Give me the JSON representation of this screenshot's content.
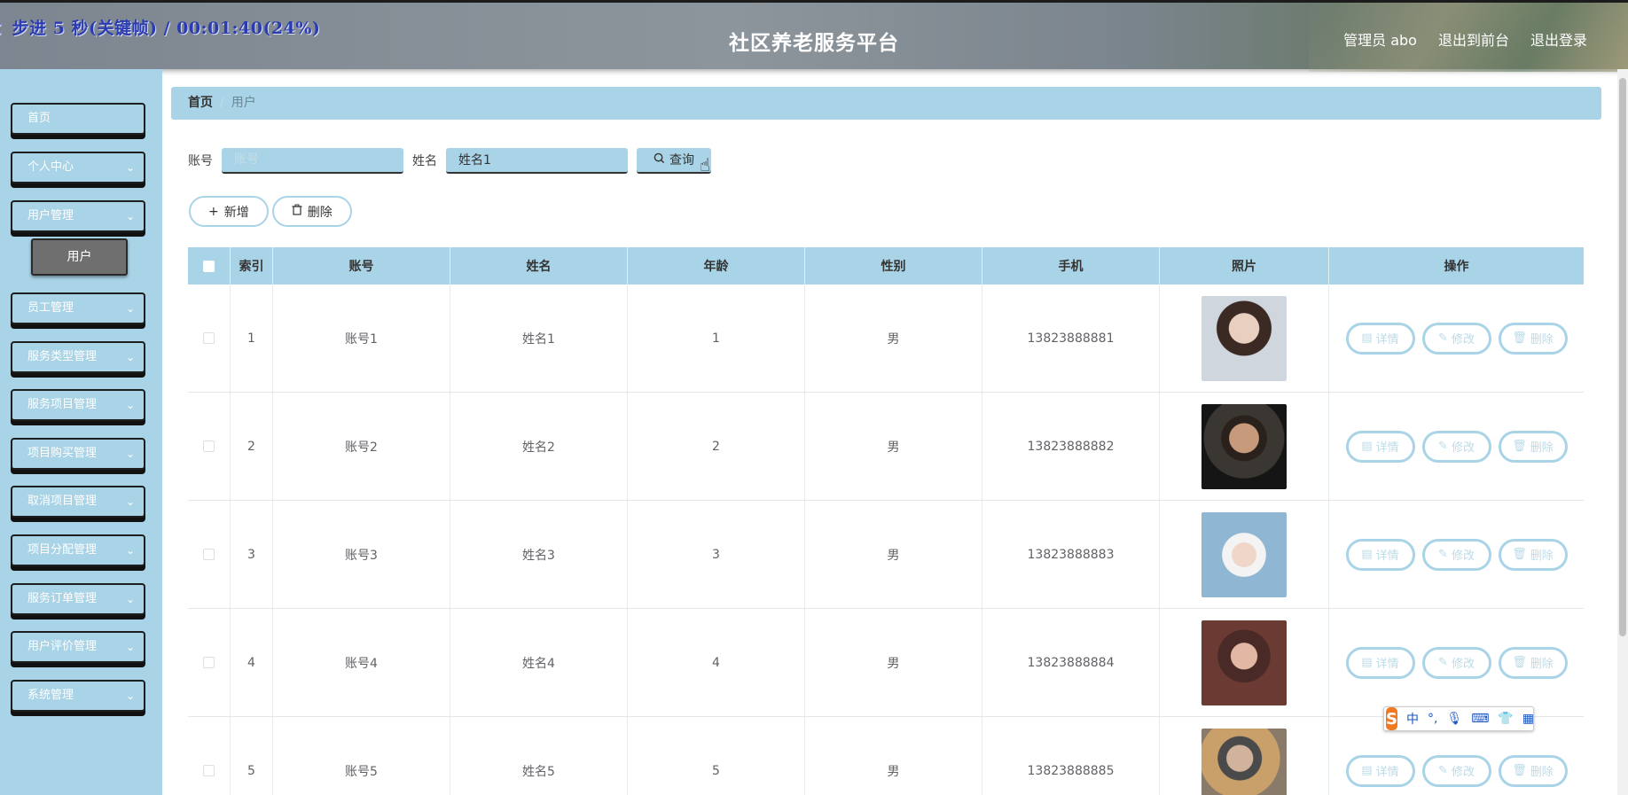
{
  "overlay": {
    "text": "：步进 5 秒(关键帧) / 00:01:40(24%)"
  },
  "header": {
    "title": "社区养老服务平台",
    "user": "管理员 abo",
    "front_link": "退出到前台",
    "logout_link": "退出登录"
  },
  "sidebar": {
    "items": [
      {
        "label": "首页",
        "has_arrow": false
      },
      {
        "label": "个人中心",
        "has_arrow": true
      },
      {
        "label": "用户管理",
        "has_arrow": true
      },
      {
        "label": "员工管理",
        "has_arrow": true
      },
      {
        "label": "服务类型管理",
        "has_arrow": true
      },
      {
        "label": "服务项目管理",
        "has_arrow": true
      },
      {
        "label": "项目购买管理",
        "has_arrow": true
      },
      {
        "label": "取消项目管理",
        "has_arrow": true
      },
      {
        "label": "项目分配管理",
        "has_arrow": true
      },
      {
        "label": "服务订单管理",
        "has_arrow": true
      },
      {
        "label": "用户评价管理",
        "has_arrow": true
      },
      {
        "label": "系统管理",
        "has_arrow": true
      }
    ],
    "submenu": {
      "label": "用户"
    }
  },
  "breadcrumb": {
    "home": "首页",
    "current": "用户"
  },
  "search": {
    "account_label": "账号",
    "account_placeholder": "账号",
    "account_value": "",
    "name_label": "姓名",
    "name_value": "姓名1",
    "query_label": "查询"
  },
  "actions": {
    "add_label": "新增",
    "delete_label": "删除"
  },
  "table": {
    "headers": {
      "index": "索引",
      "account": "账号",
      "name": "姓名",
      "age": "年龄",
      "gender": "性别",
      "phone": "手机",
      "photo": "照片",
      "ops": "操作"
    },
    "rows": [
      {
        "index": "1",
        "account": "账号1",
        "name": "姓名1",
        "age": "1",
        "gender": "男",
        "phone": "13823888881"
      },
      {
        "index": "2",
        "account": "账号2",
        "name": "姓名2",
        "age": "2",
        "gender": "男",
        "phone": "13823888882"
      },
      {
        "index": "3",
        "account": "账号3",
        "name": "姓名3",
        "age": "3",
        "gender": "男",
        "phone": "13823888883"
      },
      {
        "index": "4",
        "account": "账号4",
        "name": "姓名4",
        "age": "4",
        "gender": "男",
        "phone": "13823888884"
      },
      {
        "index": "5",
        "account": "账号5",
        "name": "姓名5",
        "age": "5",
        "gender": "男",
        "phone": "13823888885"
      }
    ],
    "row_ops": {
      "detail": "详情",
      "edit": "修改",
      "delete": "删除"
    }
  },
  "ime": {
    "logo": "S",
    "mode": "中"
  },
  "colors": {
    "accent": "#a9d3e6",
    "sidebar_bg": "#a9d3e6",
    "submenu_bg": "#6f6f6f",
    "op_text": "#bcdbe8"
  }
}
